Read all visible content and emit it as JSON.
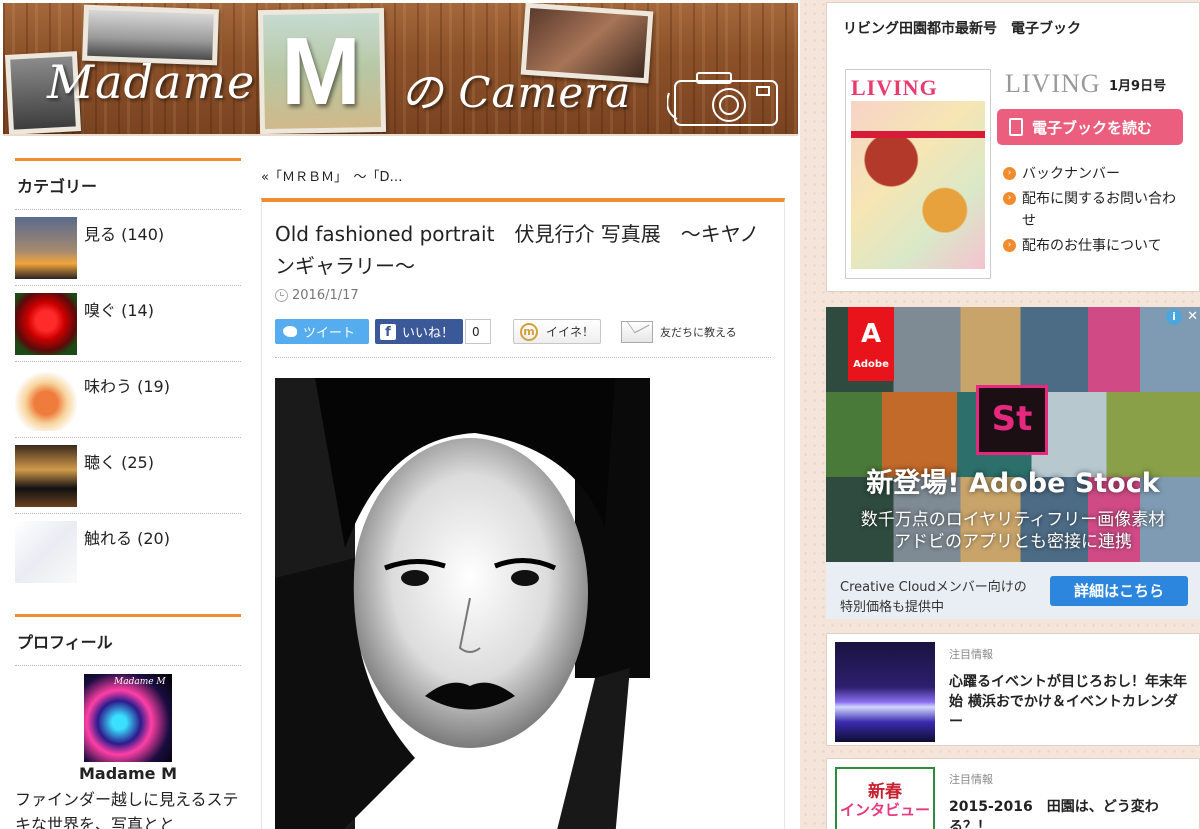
{
  "header": {
    "logo_part1": "Madame",
    "logo_m": "M",
    "logo_part2": "の Camera"
  },
  "sidebar": {
    "categories_title": "カテゴリー",
    "categories": [
      {
        "label": "見る (140)"
      },
      {
        "label": "嗅ぐ (14)"
      },
      {
        "label": "味わう (19)"
      },
      {
        "label": "聴く (25)"
      },
      {
        "label": "触れる (20)"
      }
    ],
    "profile_title": "プロフィール",
    "profile_avatar_text": "Madame M",
    "profile_name": "Madame M",
    "profile_text": "ファインダー越しに見えるステキな世界を、写真とと"
  },
  "main": {
    "prev_link": "«「ＭＲＢＭ」　～「D…",
    "post_title": "Old fashioned portrait　伏見行介 写真展　～キヤノンギャラリー～",
    "post_date": "2016/1/17",
    "share": {
      "tweet": "ツイート",
      "like": "いいね！",
      "like_count": "0",
      "mixi": "イイネ！",
      "mail": "友だちに教える"
    }
  },
  "right": {
    "ebook_title": "リビング田園都市最新号　電子ブック",
    "living_logo": "LIVING",
    "living_date": "1月9日号",
    "cover_masthead": "LIVING",
    "read_button": "電子ブックを読む",
    "links": [
      {
        "label": "バックナンバー"
      },
      {
        "label": "配布に関するお問い合わせ"
      },
      {
        "label": "配布のお仕事について"
      }
    ],
    "ad": {
      "brand": "Adobe",
      "product_icon": "St",
      "headline": "新登場! Adobe Stock",
      "sub1": "数千万点のロイヤリティフリー画像素材",
      "sub2": "アドビのアプリとも密接に連携",
      "foot1": "Creative Cloudメンバー向けの",
      "foot2": "特別価格も提供中",
      "cta": "詳細はこちら"
    },
    "news": [
      {
        "tag": "注目情報",
        "headline": "心躍るイベントが目じろおし！年末年始 横浜おでかけ＆イベントカレンダー"
      },
      {
        "tag": "注目情報",
        "headline": "2015-2016　田園は、どう変わる？！",
        "thumb_line1": "新春",
        "thumb_line2": "インタビュー"
      }
    ]
  }
}
